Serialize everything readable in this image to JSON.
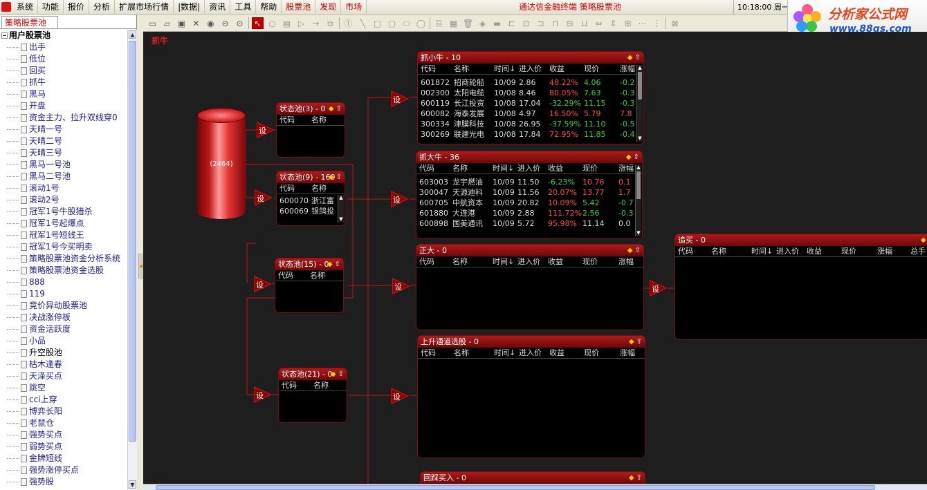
{
  "menubar": {
    "items": [
      {
        "label": "系统",
        "red": false
      },
      {
        "label": "功能",
        "red": false
      },
      {
        "label": "报价",
        "red": false
      },
      {
        "label": "分析",
        "red": false
      },
      {
        "label": "扩展市场行情",
        "red": false
      },
      {
        "label": "|数据|",
        "red": false
      },
      {
        "label": "资讯",
        "red": false
      },
      {
        "label": "工具",
        "red": false
      },
      {
        "label": "帮助",
        "red": false
      },
      {
        "label": "股票池",
        "red": true
      },
      {
        "label": "发现",
        "red": true
      },
      {
        "label": "市场",
        "red": true
      }
    ],
    "center_title": "通达信金融终端  策略股票池",
    "clock": "10:18:00 周一"
  },
  "brand": {
    "line1": "分析家公式网",
    "line2": "www.88gs.com"
  },
  "sidebar": {
    "tab_label": "策略股票池",
    "root_label": "用户股票池",
    "items": [
      "出手",
      "低位",
      "回买",
      "抓牛",
      "黑马",
      "开盘",
      "资金主力、拉升双线穿0",
      "天晴一号",
      "天晴二号",
      "天晴三号",
      "黑马一号池",
      "黑马二号池",
      "滚动1号",
      "滚动2号",
      "冠军1号牛股猎杀",
      "冠军1号起爆点",
      "冠军1号短线王",
      "冠军1号今买明卖",
      "策略股票池资金分析系统",
      "策略股票池资金选股",
      "888",
      "119",
      "竞价异动股票池",
      "决战涨停板",
      "资金活跃度",
      "小品",
      "升空股池",
      "枯木逢春",
      "天泽买点",
      "跳空",
      "cci上穿",
      "博弈长阳",
      "老鼠仓",
      "强势买点",
      "弱势买点",
      "金牌短线",
      "强势涨停买点",
      "强势股"
    ],
    "black_item": "升空股池"
  },
  "canvas": {
    "label": "抓牛",
    "source": "(2464)",
    "set_label": "设"
  },
  "status_pools": [
    {
      "title": "状态池(3) - 0",
      "cols": [
        "代码",
        "名称"
      ],
      "rows": []
    },
    {
      "title": "状态池(9) - 160",
      "cols": [
        "代码",
        "名称"
      ],
      "rows": [
        [
          "600070",
          "浙江富"
        ],
        [
          "600069",
          "银鸽投"
        ]
      ]
    },
    {
      "title": "状态池(15) - 0",
      "cols": [
        "代码",
        "名称"
      ],
      "rows": []
    },
    {
      "title": "状态池(21) - 0",
      "cols": [
        "代码",
        "名称"
      ],
      "rows": []
    }
  ],
  "result_pools": [
    {
      "title": "抓小牛 - 10",
      "cols": [
        "代码",
        "名称",
        "时间↓",
        "进入价",
        "收益",
        "现价",
        "涨幅"
      ],
      "rows": [
        [
          "601872",
          "招商轮船",
          "10/09",
          "2.86",
          "48.22%",
          "4.06",
          "-0.2"
        ],
        [
          "002300",
          "太阳电缆",
          "10/08",
          "8.46",
          "80.05%",
          "7.63",
          "-0.3"
        ],
        [
          "600119",
          "长江投资",
          "10/08",
          "17.04",
          "-32.29%",
          "11.15",
          "-0.3"
        ],
        [
          "600082",
          "海泰发展",
          "10/08",
          "4.97",
          "16.50%",
          "5.79",
          "7.8"
        ],
        [
          "300334",
          "津膜科技",
          "10/08",
          "26.95",
          "-37.59%",
          "11.10",
          "-0.5"
        ],
        [
          "300269",
          "联建光电",
          "10/08",
          "17.84",
          "72.95%",
          "11.85",
          "-0.4"
        ]
      ],
      "gain_colors": [
        "up",
        "up",
        "dn",
        "up",
        "dn",
        "up"
      ],
      "price_colors": [
        "dn",
        "dn",
        "dn",
        "up",
        "dn",
        "dn"
      ],
      "chg_colors": [
        "dn",
        "dn",
        "dn",
        "up",
        "dn",
        "dn"
      ]
    },
    {
      "title": "抓大牛 - 36",
      "cols": [
        "代码",
        "名称",
        "时间↓",
        "进入价",
        "收益",
        "现价",
        "涨幅"
      ],
      "rows": [
        [
          "603003",
          "龙宇燃油",
          "10/09",
          "11.50",
          "-6.23%",
          "10.76",
          "0.1"
        ],
        [
          "300047",
          "天源迪科",
          "10/09",
          "11.56",
          "20.07%",
          "13.77",
          "1.7"
        ],
        [
          "600705",
          "中航资本",
          "10/09",
          "20.82",
          "10.09%",
          "5.42",
          "-0.7"
        ],
        [
          "601880",
          "大连港",
          "10/09",
          "2.88",
          "111.72%",
          "2.56",
          "-0.3"
        ],
        [
          "600898",
          "国美通讯",
          "10/09",
          "5.72",
          "95.98%",
          "11.14",
          "0.0"
        ]
      ],
      "gain_colors": [
        "dn",
        "up",
        "up",
        "up",
        "up"
      ],
      "price_colors": [
        "up",
        "up",
        "dn",
        "dn",
        "wt"
      ],
      "chg_colors": [
        "up",
        "up",
        "dn",
        "dn",
        "wt"
      ]
    },
    {
      "title": "正大 - 0",
      "cols": [
        "代码",
        "名称",
        "时间↓",
        "进入价",
        "收益",
        "现价",
        "涨幅"
      ],
      "rows": []
    },
    {
      "title": "上升通道选股 - 0",
      "cols": [
        "代码",
        "名称",
        "时间↓",
        "进入价",
        "收益",
        "现价",
        "涨幅"
      ],
      "rows": []
    },
    {
      "title": "回踩买入 - 0",
      "cols": [],
      "rows": []
    },
    {
      "title": "追买 - 0",
      "cols": [
        "代码",
        "名称",
        "时间↓",
        "进入价",
        "收益",
        "现价",
        "涨幅",
        "总手"
      ],
      "rows": []
    }
  ]
}
